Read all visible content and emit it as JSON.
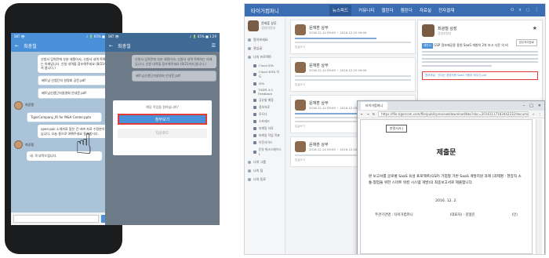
{
  "phone": {
    "status_left": "SKT 👁",
    "status_right": "♪ 🔋 65% ■ 1:29",
    "chat_title": "최광철",
    "menu_icon": "hamburger-icon",
    "back_icon": "back-arrow-icon",
    "messages": [
      "신청서 입력란에 부분 채웠어서, 신청서 내역 목록하는 아래입니다. 신청 내역을 참조해주세요 (8/21까지 봅니다.)",
      "베트남 신앱단지 설명회 공문.pdf",
      "베트남신앱단지설명회 안내문.pdf",
      "TigerCompany_IR for M&A Center.pptx",
      "open-poc 소개자료 맞은 건 바까 자료 수정본이 있습니다. 오늘 중으로 여쭤주세요 질려봅시다.",
      "네. 꼭 부탁드립니다."
    ],
    "sender": "최광철",
    "send_label": "전송",
    "dialog_message": "해당 작업을 원하십니까?",
    "dialog_primary": "첨부보기",
    "dialog_secondary": "다운로드",
    "chat2_title": "최광철"
  },
  "desktop": {
    "brand": "타이거컴퍼니",
    "nav": [
      "뉴스피드",
      "커뮤니티",
      "캘린더",
      "캠린더",
      "자료실",
      "전자결재"
    ],
    "active_nav": "뉴스피드",
    "profile_name": "윤재훈 상무",
    "profile_dept": "경영지원부",
    "sidebar_items": [
      "알아보세요",
      "관심글",
      "나의 프로젝트",
      "나의 사용자"
    ],
    "sidebar_subs": [
      "Cloud SFA",
      "Cloud 4SFA 지도",
      "SFA",
      "TIGER 4.0 Feedback",
      "공유할 예정",
      "정보자료",
      "모두다",
      "스프레드",
      "마케팅 자료",
      "마케팅 작업 목표",
      "아웃사이드",
      "운영 워크스페이스 1"
    ],
    "sidebar_more": [
      "나의 그룹",
      "나의 팀",
      "나의 동료"
    ],
    "post_name": "윤재훈 상무",
    "post_meta": "2016.12.14 09:00 ~ 2016.12.20 09:00",
    "post_footer": "답글쓰기",
    "panel_name": "최광철 상장",
    "panel_dept": "경영지원부",
    "panel_tag": "제안서",
    "panel_title": "GSP 정보제공용 용원 SaaS 개발처 2차 보고 다운 의 비",
    "panel_attach": "첨부파일 · 관리는 경영지원 SaaS 가중치 최우선.pdf",
    "panel_button": "업무처리완료"
  },
  "browser": {
    "tab_label": "타이거컴퍼니",
    "url": "https://file.tigercom.com/file/publicpreview/download/bbs?doc=20161117183442232/document",
    "doc_tag": "판정사서 |",
    "doc_title": "제출문",
    "doc_body": "본 보고서를 글로벌 SaaS 육성 프로젝트(GSP) 기업형 가반 SaaS 개발지원 과제 (과제명 : 현장직 소통·협업을 위한 스마트 워킹 시스템 개발)의 최종보고서로 제출합니다.",
    "doc_date": "2016. 12. 2.",
    "doc_sign_left": "주관기관명 : 타이거컴퍼니",
    "doc_sign_right": "(대표자) : 김형진",
    "doc_sign_mark": "(인)"
  }
}
